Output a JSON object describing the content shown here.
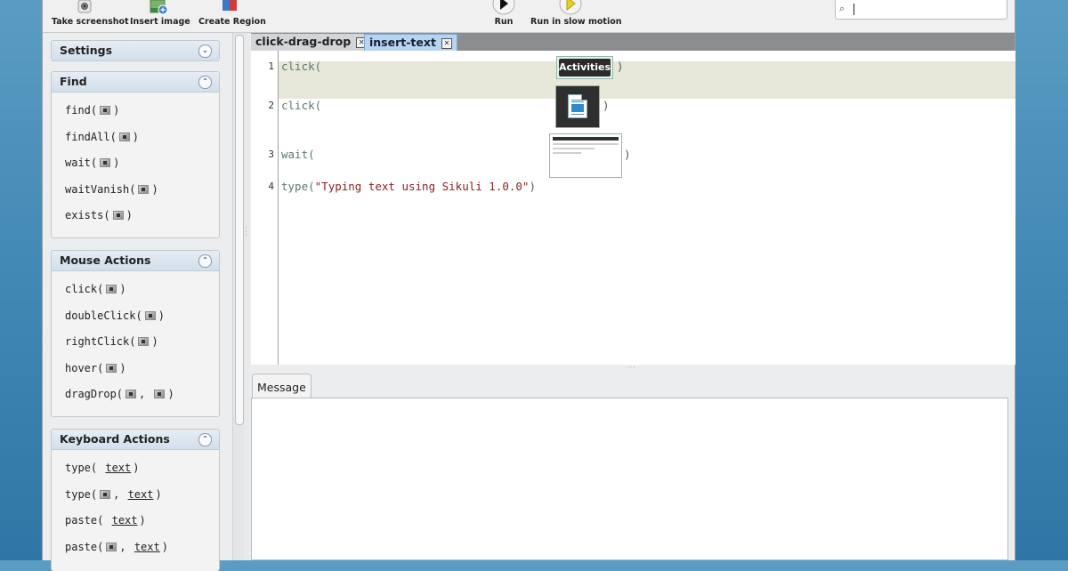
{
  "toolbar": {
    "take_screenshot": "Take screenshot",
    "insert_image": "Insert image",
    "create_region": "Create Region",
    "run": "Run",
    "run_slow": "Run in slow motion",
    "search_value": ""
  },
  "sidebar": {
    "settings": {
      "title": "Settings"
    },
    "find": {
      "title": "Find",
      "items": [
        "find(",
        "findAll(",
        "wait(",
        "waitVanish(",
        "exists("
      ]
    },
    "mouse": {
      "title": "Mouse Actions",
      "items": [
        "click(",
        "doubleClick(",
        "rightClick(",
        "hover(",
        "dragDrop("
      ]
    },
    "keyboard": {
      "title": "Keyboard Actions",
      "items": [
        "type(",
        "type(",
        "paste(",
        "paste("
      ],
      "param": "text"
    }
  },
  "tabs": [
    {
      "label": "click-drag-drop"
    },
    {
      "label": "insert-text"
    }
  ],
  "editor": {
    "lines": [
      {
        "num": "1",
        "fn": "click(",
        "close": ")",
        "thumb_text": "Activities"
      },
      {
        "num": "2",
        "fn": "click(",
        "close": ")"
      },
      {
        "num": "3",
        "fn": "wait(",
        "close": ")"
      },
      {
        "num": "4",
        "fn": "type(",
        "arg": "\"Typing text using Sikuli 1.0.0\"",
        "close": ")"
      }
    ]
  },
  "message": {
    "tab_label": "Message",
    "content": ""
  },
  "colors": {
    "accent": "#b8d4ef",
    "string": "#8b2222",
    "keyword": "#5b7a6b",
    "highlight": "#e7e7da"
  },
  "icons": [
    "camera-icon",
    "insert-image-icon",
    "create-region-icon",
    "run-icon",
    "run-slow-icon",
    "search-icon",
    "chevron-down-icon",
    "chevron-up-icon",
    "image-placeholder-icon",
    "close-tab-icon"
  ]
}
